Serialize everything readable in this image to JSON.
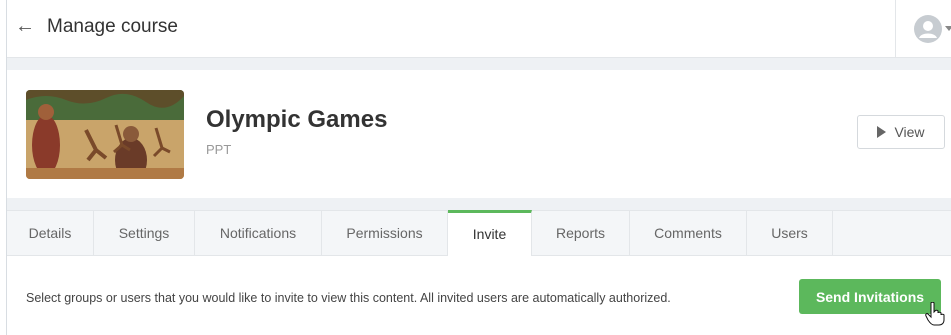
{
  "header": {
    "title": "Manage course",
    "back_icon": "arrow-left-icon",
    "avatar_icon": "user-avatar-icon"
  },
  "course": {
    "title": "Olympic Games",
    "type": "PPT",
    "view_label": "View"
  },
  "tabs": [
    {
      "label": "Details",
      "active": false
    },
    {
      "label": "Settings",
      "active": false
    },
    {
      "label": "Notifications",
      "active": false
    },
    {
      "label": "Permissions",
      "active": false
    },
    {
      "label": "Invite",
      "active": true
    },
    {
      "label": "Reports",
      "active": false
    },
    {
      "label": "Comments",
      "active": false
    },
    {
      "label": "Users",
      "active": false
    }
  ],
  "invite": {
    "description": "Select groups or users that you would like to invite to view this content. All invited users are automatically authorized.",
    "send_label": "Send Invitations"
  },
  "colors": {
    "accent": "#5cb85c",
    "band": "#eef1f4"
  }
}
